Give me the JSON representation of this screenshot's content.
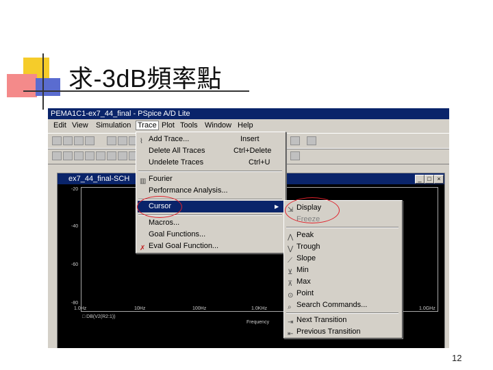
{
  "slide": {
    "title": "求-3dB頻率點",
    "page_number": "12"
  },
  "window": {
    "title": "PEMA1C1-ex7_44_final - PSpice A/D Lite",
    "menus": [
      "Edit",
      "View",
      "Simulation",
      "Trace",
      "Plot",
      "Tools",
      "Window",
      "Help"
    ]
  },
  "subwindow": {
    "title": "ex7_44_final-SCH",
    "buttons": [
      "_",
      "□",
      "×"
    ]
  },
  "plot": {
    "y_ticks": [
      "-20",
      "-40",
      "-60",
      "-80"
    ],
    "x_ticks": [
      "1.0Hz",
      "10Hz",
      "100Hz",
      "1.0KHz",
      "1.0GHz"
    ],
    "trace_legend": "□ DB(V2(R2:1))",
    "xlabel": "Frequency"
  },
  "trace_menu": {
    "items": [
      {
        "label": "Add Trace...",
        "shortcut": "Insert"
      },
      {
        "label": "Delete All Traces",
        "shortcut": "Ctrl+Delete"
      },
      {
        "label": "Undelete Traces",
        "shortcut": "Ctrl+U"
      },
      {
        "label": "Fourier",
        "shortcut": ""
      },
      {
        "label": "Performance Analysis...",
        "shortcut": ""
      },
      {
        "label": "Cursor",
        "shortcut": "▶"
      },
      {
        "label": "Macros...",
        "shortcut": ""
      },
      {
        "label": "Goal Functions...",
        "shortcut": ""
      },
      {
        "label": "Eval Goal Function...",
        "shortcut": ""
      }
    ]
  },
  "cursor_menu": {
    "items": [
      {
        "label": "Display"
      },
      {
        "label": "Freeze"
      },
      {
        "label": "Peak"
      },
      {
        "label": "Trough"
      },
      {
        "label": "Slope"
      },
      {
        "label": "Min"
      },
      {
        "label": "Max"
      },
      {
        "label": "Point"
      },
      {
        "label": "Search Commands..."
      },
      {
        "label": "Next Transition"
      },
      {
        "label": "Previous Transition"
      }
    ]
  },
  "colors": {
    "highlight": "#0a246a",
    "annotation": "#e0202a",
    "deco_yellow": "#f5cc2a",
    "deco_red": "#f06060",
    "deco_blue": "#5a6cd0"
  }
}
